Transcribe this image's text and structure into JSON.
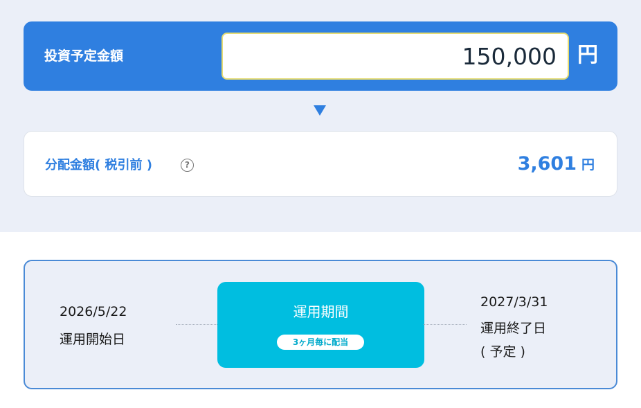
{
  "investment": {
    "label": "投資予定金額",
    "amount": "150,000",
    "unit": "円"
  },
  "distribution": {
    "label": "分配金額( 税引前 )",
    "help_icon": "question-circle-icon",
    "help_glyph": "?",
    "value": "3,601",
    "unit": "円"
  },
  "period": {
    "start_date": "2026/5/22",
    "start_label": "運用開始日",
    "title": "運用期間",
    "badge": "3ヶ月毎に配当",
    "end_date": "2027/3/31",
    "end_label": "運用終了日",
    "end_note": "( 予定 )"
  },
  "colors": {
    "primary": "#2f7fe0",
    "accent": "#00bee0",
    "background": "#ebeff8"
  }
}
